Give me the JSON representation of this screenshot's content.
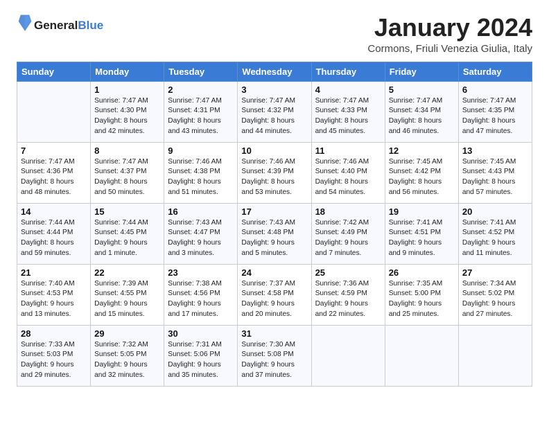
{
  "header": {
    "logo_general": "General",
    "logo_blue": "Blue",
    "month_title": "January 2024",
    "location": "Cormons, Friuli Venezia Giulia, Italy"
  },
  "weekdays": [
    "Sunday",
    "Monday",
    "Tuesday",
    "Wednesday",
    "Thursday",
    "Friday",
    "Saturday"
  ],
  "weeks": [
    [
      {
        "day": "",
        "sunrise": "",
        "sunset": "",
        "daylight": ""
      },
      {
        "day": "1",
        "sunrise": "Sunrise: 7:47 AM",
        "sunset": "Sunset: 4:30 PM",
        "daylight1": "Daylight: 8 hours",
        "daylight2": "and 42 minutes."
      },
      {
        "day": "2",
        "sunrise": "Sunrise: 7:47 AM",
        "sunset": "Sunset: 4:31 PM",
        "daylight1": "Daylight: 8 hours",
        "daylight2": "and 43 minutes."
      },
      {
        "day": "3",
        "sunrise": "Sunrise: 7:47 AM",
        "sunset": "Sunset: 4:32 PM",
        "daylight1": "Daylight: 8 hours",
        "daylight2": "and 44 minutes."
      },
      {
        "day": "4",
        "sunrise": "Sunrise: 7:47 AM",
        "sunset": "Sunset: 4:33 PM",
        "daylight1": "Daylight: 8 hours",
        "daylight2": "and 45 minutes."
      },
      {
        "day": "5",
        "sunrise": "Sunrise: 7:47 AM",
        "sunset": "Sunset: 4:34 PM",
        "daylight1": "Daylight: 8 hours",
        "daylight2": "and 46 minutes."
      },
      {
        "day": "6",
        "sunrise": "Sunrise: 7:47 AM",
        "sunset": "Sunset: 4:35 PM",
        "daylight1": "Daylight: 8 hours",
        "daylight2": "and 47 minutes."
      }
    ],
    [
      {
        "day": "7",
        "sunrise": "Sunrise: 7:47 AM",
        "sunset": "Sunset: 4:36 PM",
        "daylight1": "Daylight: 8 hours",
        "daylight2": "and 48 minutes."
      },
      {
        "day": "8",
        "sunrise": "Sunrise: 7:47 AM",
        "sunset": "Sunset: 4:37 PM",
        "daylight1": "Daylight: 8 hours",
        "daylight2": "and 50 minutes."
      },
      {
        "day": "9",
        "sunrise": "Sunrise: 7:46 AM",
        "sunset": "Sunset: 4:38 PM",
        "daylight1": "Daylight: 8 hours",
        "daylight2": "and 51 minutes."
      },
      {
        "day": "10",
        "sunrise": "Sunrise: 7:46 AM",
        "sunset": "Sunset: 4:39 PM",
        "daylight1": "Daylight: 8 hours",
        "daylight2": "and 53 minutes."
      },
      {
        "day": "11",
        "sunrise": "Sunrise: 7:46 AM",
        "sunset": "Sunset: 4:40 PM",
        "daylight1": "Daylight: 8 hours",
        "daylight2": "and 54 minutes."
      },
      {
        "day": "12",
        "sunrise": "Sunrise: 7:45 AM",
        "sunset": "Sunset: 4:42 PM",
        "daylight1": "Daylight: 8 hours",
        "daylight2": "and 56 minutes."
      },
      {
        "day": "13",
        "sunrise": "Sunrise: 7:45 AM",
        "sunset": "Sunset: 4:43 PM",
        "daylight1": "Daylight: 8 hours",
        "daylight2": "and 57 minutes."
      }
    ],
    [
      {
        "day": "14",
        "sunrise": "Sunrise: 7:44 AM",
        "sunset": "Sunset: 4:44 PM",
        "daylight1": "Daylight: 8 hours",
        "daylight2": "and 59 minutes."
      },
      {
        "day": "15",
        "sunrise": "Sunrise: 7:44 AM",
        "sunset": "Sunset: 4:45 PM",
        "daylight1": "Daylight: 9 hours",
        "daylight2": "and 1 minute."
      },
      {
        "day": "16",
        "sunrise": "Sunrise: 7:43 AM",
        "sunset": "Sunset: 4:47 PM",
        "daylight1": "Daylight: 9 hours",
        "daylight2": "and 3 minutes."
      },
      {
        "day": "17",
        "sunrise": "Sunrise: 7:43 AM",
        "sunset": "Sunset: 4:48 PM",
        "daylight1": "Daylight: 9 hours",
        "daylight2": "and 5 minutes."
      },
      {
        "day": "18",
        "sunrise": "Sunrise: 7:42 AM",
        "sunset": "Sunset: 4:49 PM",
        "daylight1": "Daylight: 9 hours",
        "daylight2": "and 7 minutes."
      },
      {
        "day": "19",
        "sunrise": "Sunrise: 7:41 AM",
        "sunset": "Sunset: 4:51 PM",
        "daylight1": "Daylight: 9 hours",
        "daylight2": "and 9 minutes."
      },
      {
        "day": "20",
        "sunrise": "Sunrise: 7:41 AM",
        "sunset": "Sunset: 4:52 PM",
        "daylight1": "Daylight: 9 hours",
        "daylight2": "and 11 minutes."
      }
    ],
    [
      {
        "day": "21",
        "sunrise": "Sunrise: 7:40 AM",
        "sunset": "Sunset: 4:53 PM",
        "daylight1": "Daylight: 9 hours",
        "daylight2": "and 13 minutes."
      },
      {
        "day": "22",
        "sunrise": "Sunrise: 7:39 AM",
        "sunset": "Sunset: 4:55 PM",
        "daylight1": "Daylight: 9 hours",
        "daylight2": "and 15 minutes."
      },
      {
        "day": "23",
        "sunrise": "Sunrise: 7:38 AM",
        "sunset": "Sunset: 4:56 PM",
        "daylight1": "Daylight: 9 hours",
        "daylight2": "and 17 minutes."
      },
      {
        "day": "24",
        "sunrise": "Sunrise: 7:37 AM",
        "sunset": "Sunset: 4:58 PM",
        "daylight1": "Daylight: 9 hours",
        "daylight2": "and 20 minutes."
      },
      {
        "day": "25",
        "sunrise": "Sunrise: 7:36 AM",
        "sunset": "Sunset: 4:59 PM",
        "daylight1": "Daylight: 9 hours",
        "daylight2": "and 22 minutes."
      },
      {
        "day": "26",
        "sunrise": "Sunrise: 7:35 AM",
        "sunset": "Sunset: 5:00 PM",
        "daylight1": "Daylight: 9 hours",
        "daylight2": "and 25 minutes."
      },
      {
        "day": "27",
        "sunrise": "Sunrise: 7:34 AM",
        "sunset": "Sunset: 5:02 PM",
        "daylight1": "Daylight: 9 hours",
        "daylight2": "and 27 minutes."
      }
    ],
    [
      {
        "day": "28",
        "sunrise": "Sunrise: 7:33 AM",
        "sunset": "Sunset: 5:03 PM",
        "daylight1": "Daylight: 9 hours",
        "daylight2": "and 29 minutes."
      },
      {
        "day": "29",
        "sunrise": "Sunrise: 7:32 AM",
        "sunset": "Sunset: 5:05 PM",
        "daylight1": "Daylight: 9 hours",
        "daylight2": "and 32 minutes."
      },
      {
        "day": "30",
        "sunrise": "Sunrise: 7:31 AM",
        "sunset": "Sunset: 5:06 PM",
        "daylight1": "Daylight: 9 hours",
        "daylight2": "and 35 minutes."
      },
      {
        "day": "31",
        "sunrise": "Sunrise: 7:30 AM",
        "sunset": "Sunset: 5:08 PM",
        "daylight1": "Daylight: 9 hours",
        "daylight2": "and 37 minutes."
      },
      {
        "day": "",
        "sunrise": "",
        "sunset": "",
        "daylight1": "",
        "daylight2": ""
      },
      {
        "day": "",
        "sunrise": "",
        "sunset": "",
        "daylight1": "",
        "daylight2": ""
      },
      {
        "day": "",
        "sunrise": "",
        "sunset": "",
        "daylight1": "",
        "daylight2": ""
      }
    ]
  ]
}
